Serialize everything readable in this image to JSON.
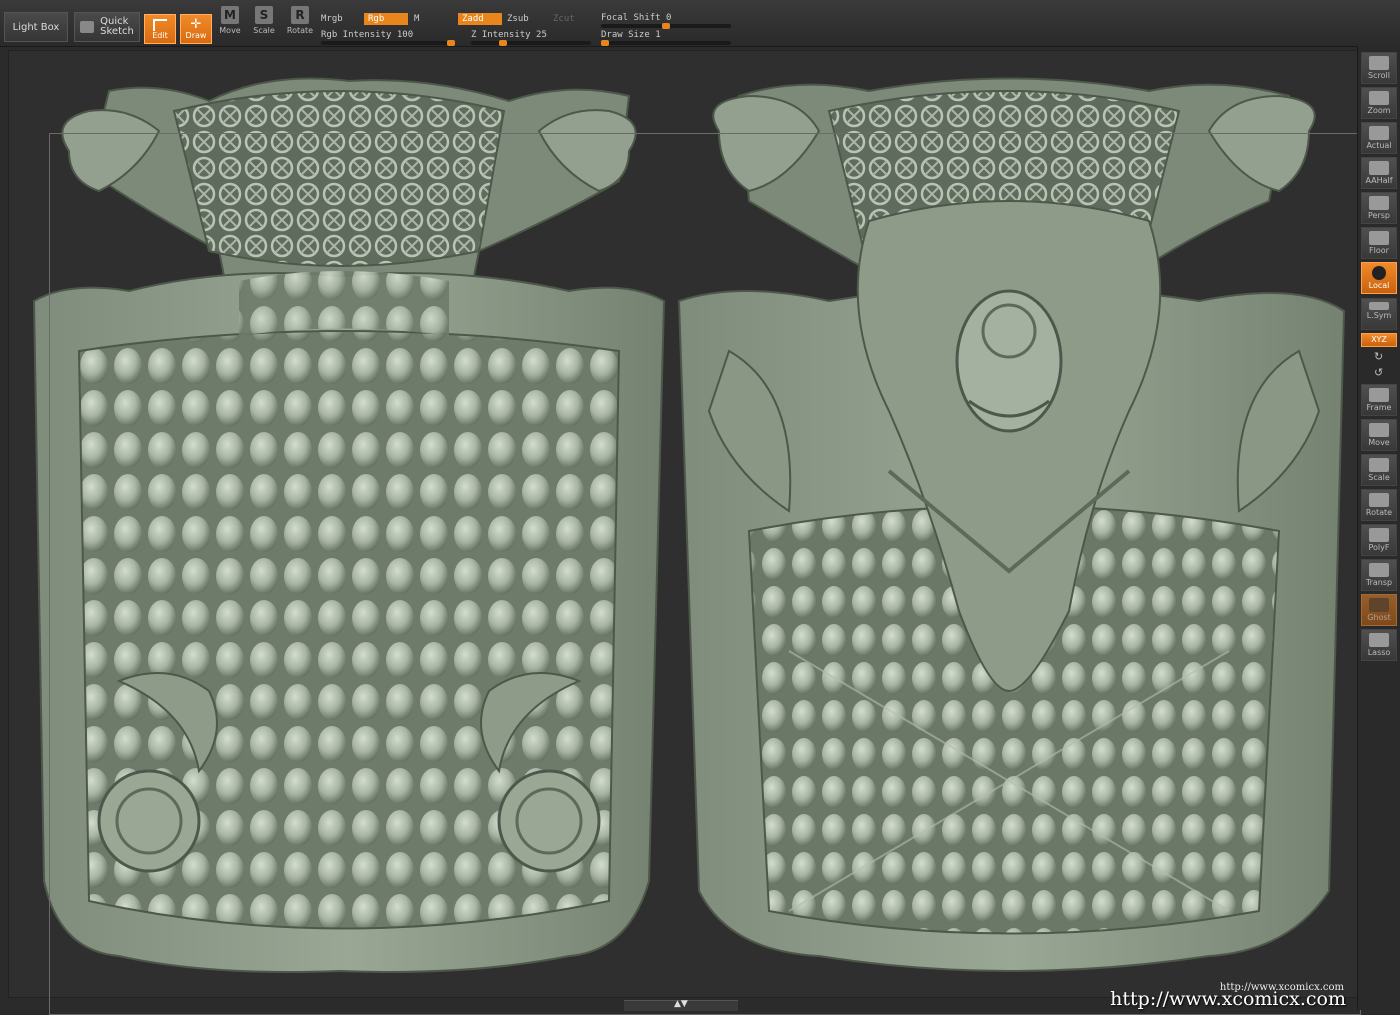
{
  "topbar": {
    "light_box": "Light Box",
    "quick_sketch_line1": "Quick",
    "quick_sketch_line2": "Sketch",
    "edit": "Edit",
    "draw": "Draw",
    "move": "Move",
    "scale": "Scale",
    "rotate": "Rotate",
    "mrgb": "Mrgb",
    "rgb": "Rgb",
    "m": "M",
    "zadd": "Zadd",
    "zsub": "Zsub",
    "zcut": "Zcut",
    "rgb_intensity_label": "Rgb Intensity",
    "rgb_intensity_value": "100",
    "rgb_intensity_level": 1.0,
    "z_intensity_label": "Z Intensity",
    "z_intensity_value": "25",
    "z_intensity_level": 0.25,
    "focal_shift_label": "Focal Shift",
    "focal_shift_value": "0",
    "focal_shift_level": 0.5,
    "draw_size_label": "Draw Size",
    "draw_size_value": "1",
    "draw_size_level": 0.0
  },
  "rightbar": {
    "scroll": "Scroll",
    "zoom": "Zoom",
    "actual": "Actual",
    "aahalf": "AAHalf",
    "persp": "Persp",
    "floor": "Floor",
    "local": "Local",
    "lsym": "L.Sym",
    "xyz": "XYZ",
    "frame": "Frame",
    "move": "Move",
    "scale": "Scale",
    "rotate": "Rotate",
    "polyf": "PolyF",
    "transp": "Transp",
    "ghost": "Ghost",
    "lasso": "Lasso"
  },
  "watermark": {
    "small": "http://www.xcomicx.com",
    "large": "http://www.xcomicx.com"
  },
  "colors": {
    "accent": "#e8861d",
    "model": "#a9b5a4",
    "model_shadow": "#5b6658",
    "background": "#2f2f2f"
  }
}
